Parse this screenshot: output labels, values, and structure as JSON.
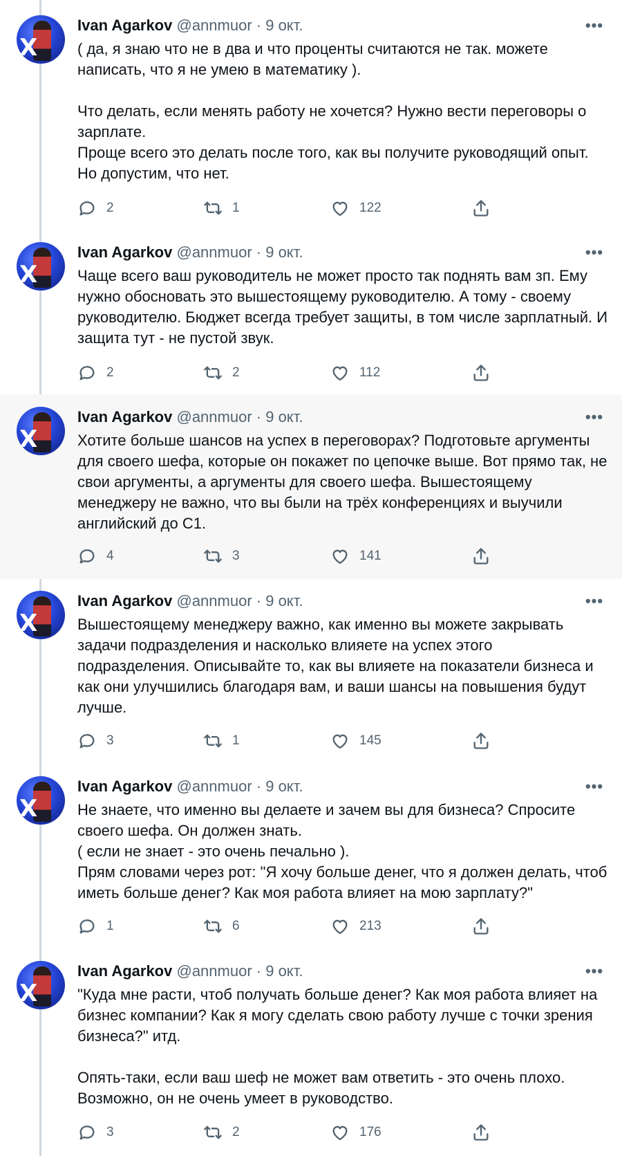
{
  "tweets": [
    {
      "author": "Ivan Agarkov",
      "handle": "@annmuor",
      "date": "· 9 окт.",
      "text": "( да, я знаю что не в два и что проценты считаются не так. можете написать, что я не умею в математику ).\n\nЧто делать, если менять работу не хочется? Нужно вести переговоры о зарплате.\nПроще всего это делать после того, как вы получите руководящий опыт. Но допустим, что нет.",
      "replies": "2",
      "retweets": "1",
      "likes": "122"
    },
    {
      "author": "Ivan Agarkov",
      "handle": "@annmuor",
      "date": "· 9 окт.",
      "text": "Чаще всего ваш руководитель не может просто так поднять вам зп. Ему нужно обосновать это вышестоящему руководителю. А тому - своему руководителю. Бюджет всегда требует защиты, в том числе зарплатный. И защита тут - не пустой звук.",
      "replies": "2",
      "retweets": "2",
      "likes": "112"
    },
    {
      "author": "Ivan Agarkov",
      "handle": "@annmuor",
      "date": "· 9 окт.",
      "text": "Хотите больше шансов на успех в переговорах? Подготовьте аргументы для своего шефа, которые он покажет по цепочке выше. Вот прямо так, не свои аргументы, а аргументы для своего шефа. Вышестоящему менеджеру не важно, что вы были на трёх конференциях и выучили английский до С1.",
      "replies": "4",
      "retweets": "3",
      "likes": "141"
    },
    {
      "author": "Ivan Agarkov",
      "handle": "@annmuor",
      "date": "· 9 окт.",
      "text": "Вышестоящему менеджеру важно, как именно вы можете закрывать задачи подразделения и насколько влияете на успех этого подразделения. Описывайте то, как вы влияете на показатели бизнеса и как они улучшились благодаря вам, и ваши шансы на повышения будут лучше.",
      "replies": "3",
      "retweets": "1",
      "likes": "145"
    },
    {
      "author": "Ivan Agarkov",
      "handle": "@annmuor",
      "date": "· 9 окт.",
      "text": "Не знаете, что именно вы делаете и зачем вы для бизнеса? Спросите своего шефа. Он должен знать.\n( если не знает - это очень печально ).\nПрям словами через рот: \"Я хочу больше денег, что я должен делать, чтоб иметь больше денег? Как моя работа влияет на мою зарплату?\"",
      "replies": "1",
      "retweets": "6",
      "likes": "213"
    },
    {
      "author": "Ivan Agarkov",
      "handle": "@annmuor",
      "date": "· 9 окт.",
      "text": "\"Куда мне расти, чтоб получать больше денег? Как моя работа влияет на бизнес компании? Как я могу сделать свою работу лучше с точки зрения бизнеса?\" итд.\n\nОпять-таки, если ваш шеф не может вам ответить - это очень плохо. Возможно, он не очень умеет в руководство.",
      "replies": "3",
      "retweets": "2",
      "likes": "176"
    }
  ]
}
